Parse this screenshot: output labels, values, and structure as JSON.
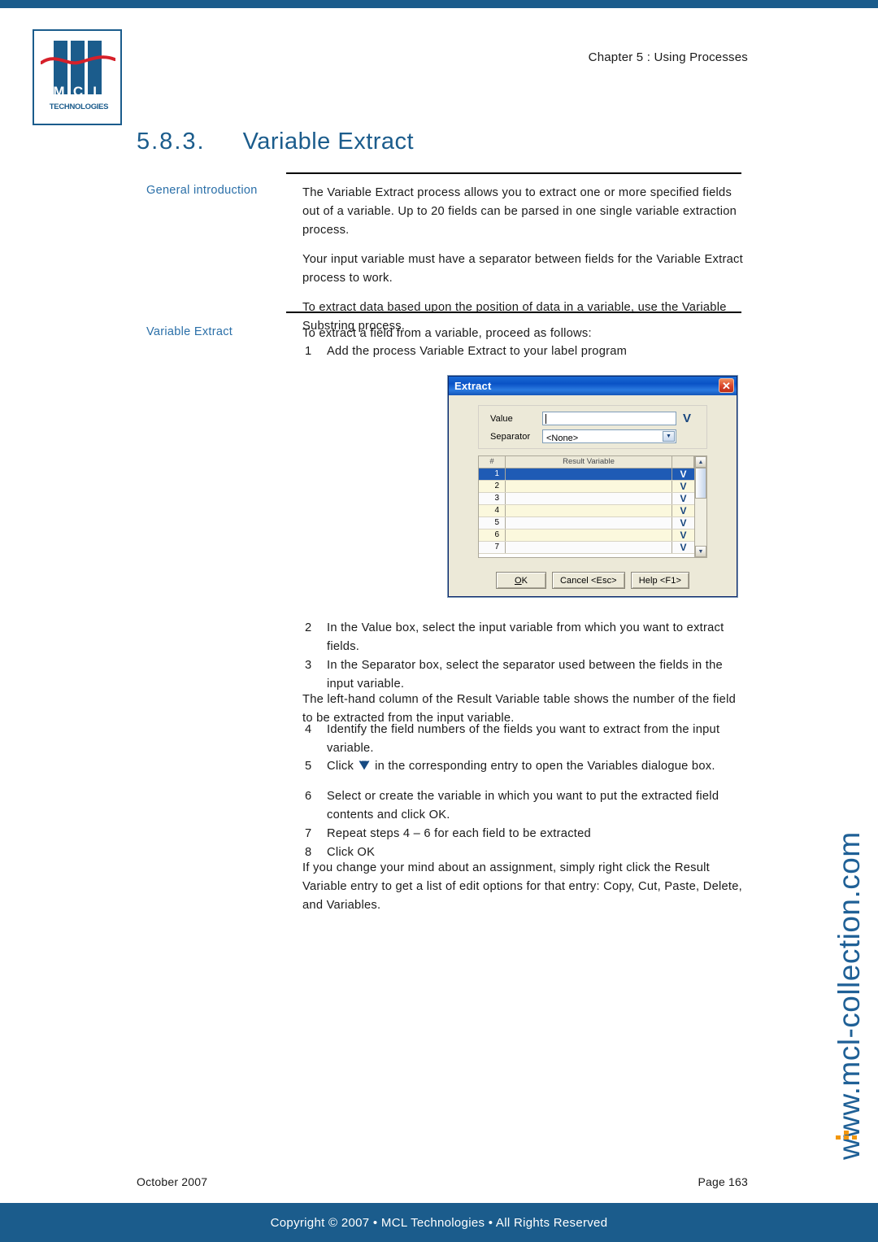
{
  "header": {
    "chapter": "Chapter 5 : Using Processes",
    "logo": {
      "letters": [
        "M",
        "C",
        "L"
      ],
      "wordmark": "TECHNOLOGIES",
      "brand_color": "#1b5c8c",
      "wave_color": "#d6202a"
    }
  },
  "section": {
    "number": "5.8.3.",
    "title": "Variable Extract",
    "title_color": "#1b5c8c"
  },
  "general_intro": {
    "label": "General introduction",
    "paragraphs": [
      "The Variable Extract process allows you to extract one or more specified fields out of a variable. Up to 20 fields can be parsed in one single variable extraction process.",
      "Your input variable must have a separator between fields for the Variable Extract process to work.",
      "To extract data based upon the position of data in a variable, use the Variable Substring process."
    ]
  },
  "variable_extract": {
    "label": "Variable Extract",
    "lead": "To extract a field from a variable, proceed as follows:",
    "step1_num": "1",
    "step1_text": "Add the process Variable Extract to your label program",
    "steps": [
      {
        "n": "2",
        "text": "In the Value box, select the input variable from which you want to extract fields."
      },
      {
        "n": "3",
        "text": "In the Separator box, select the separator used between the fields in the input variable."
      }
    ],
    "note1": "The left-hand column of the Result Variable table shows the number of the field to be extracted from the input variable.",
    "steps2": [
      {
        "n": "4",
        "text": "Identify the field numbers of the fields you want to extract from the input variable."
      }
    ],
    "step5": {
      "n": "5",
      "text_before": "Click",
      "icon": "variable-picker-v-icon",
      "text_after": "in the corresponding entry to open the Variables dialogue box."
    },
    "steps3": [
      {
        "n": "6",
        "text": "Select or create the variable in which you want to put the extracted field contents and click OK."
      },
      {
        "n": "7",
        "text": "Repeat steps 4 – 6 for each field to be extracted"
      },
      {
        "n": "8",
        "text": "Click OK"
      }
    ],
    "note2": "If you change your mind about an assignment, simply right click the Result Variable entry to get a list of edit options for that entry: Copy, Cut, Paste, Delete, and Variables."
  },
  "dialog": {
    "title": "Extract",
    "close_glyph": "✕",
    "fields": [
      {
        "label": "Value",
        "value": "",
        "control": "text-with-variable-picker",
        "picker_glyph": "V"
      },
      {
        "label": "Separator",
        "value": "<None>",
        "control": "combobox",
        "arrow_glyph": "▼"
      }
    ],
    "table": {
      "headers": [
        "#",
        "Result Variable",
        ""
      ],
      "rows": [
        {
          "num": "1",
          "value": "",
          "picker": "V",
          "selected": true
        },
        {
          "num": "2",
          "value": "",
          "picker": "V",
          "selected": false
        },
        {
          "num": "3",
          "value": "",
          "picker": "V",
          "selected": false
        },
        {
          "num": "4",
          "value": "",
          "picker": "V",
          "selected": false
        },
        {
          "num": "5",
          "value": "",
          "picker": "V",
          "selected": false
        },
        {
          "num": "6",
          "value": "",
          "picker": "V",
          "selected": false
        },
        {
          "num": "7",
          "value": "",
          "picker": "V",
          "selected": false
        }
      ],
      "scroll_up": "▲",
      "scroll_down": "▼"
    },
    "buttons": [
      {
        "label_u": "O",
        "label_rest": "K",
        "name": "ok"
      },
      {
        "label": "Cancel <Esc>",
        "name": "cancel"
      },
      {
        "label": "Help <F1>",
        "name": "help"
      }
    ],
    "selection_color": "#1f5bb5",
    "row_alt_color": "#fbf8dd"
  },
  "watermark": {
    "text": "www.mcl-collection.com",
    "color": "#1f6096",
    "icon_color": "#f2970d"
  },
  "footer": {
    "date": "October 2007",
    "page": "Page  163",
    "copyright": "Copyright © 2007 • MCL Technologies • All Rights Reserved",
    "bar_color": "#1b5c8c"
  }
}
